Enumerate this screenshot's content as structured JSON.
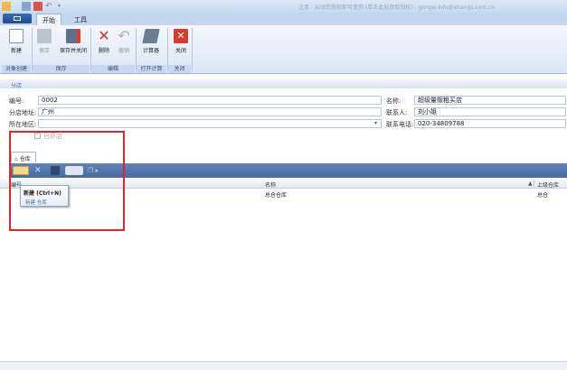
{
  "window": {
    "title": "注意 - 启动您授权即可使用 (单击此处获取授权) - gongsi.info@ebangs.com.cn"
  },
  "tabs": [
    {
      "label": "开始"
    },
    {
      "label": "工具"
    }
  ],
  "ribbon": {
    "buttons": {
      "new": "新建",
      "save": "保存",
      "save_close": "保存并关闭",
      "delete": "删除",
      "undo": "撤销",
      "calculator": "计算器",
      "close": "关闭"
    },
    "groups": {
      "new": "对象创建",
      "save": "保存",
      "edit": "编辑",
      "open_calc": "打开计算",
      "close": "关闭"
    }
  },
  "form": {
    "section": "分店",
    "code_label": "编号:",
    "code_value": "0002",
    "address_label": "分店地址:",
    "address_value": "广州",
    "region_label": "所在地区:",
    "region_value": "",
    "name_label": "名称:",
    "name_value": "超级量贩粗买店",
    "contact_label": "联系人:",
    "contact_value": "刘小姐",
    "phone_label": "联系电话:",
    "phone_value": "020-34809788",
    "checkbox_label": "已停店"
  },
  "subtab": {
    "label": "仓库"
  },
  "grid": {
    "columns": [
      "编号",
      "名称",
      "上级仓库"
    ],
    "rows": [
      {
        "name": "总仓仓库",
        "parent": "总仓"
      }
    ]
  },
  "tooltip": {
    "title": "新建 (Ctrl+N)",
    "body": "新建 仓库"
  },
  "colors": {
    "highlight_box": "#e0242b",
    "grid_toolbar": "#5f84bb"
  }
}
